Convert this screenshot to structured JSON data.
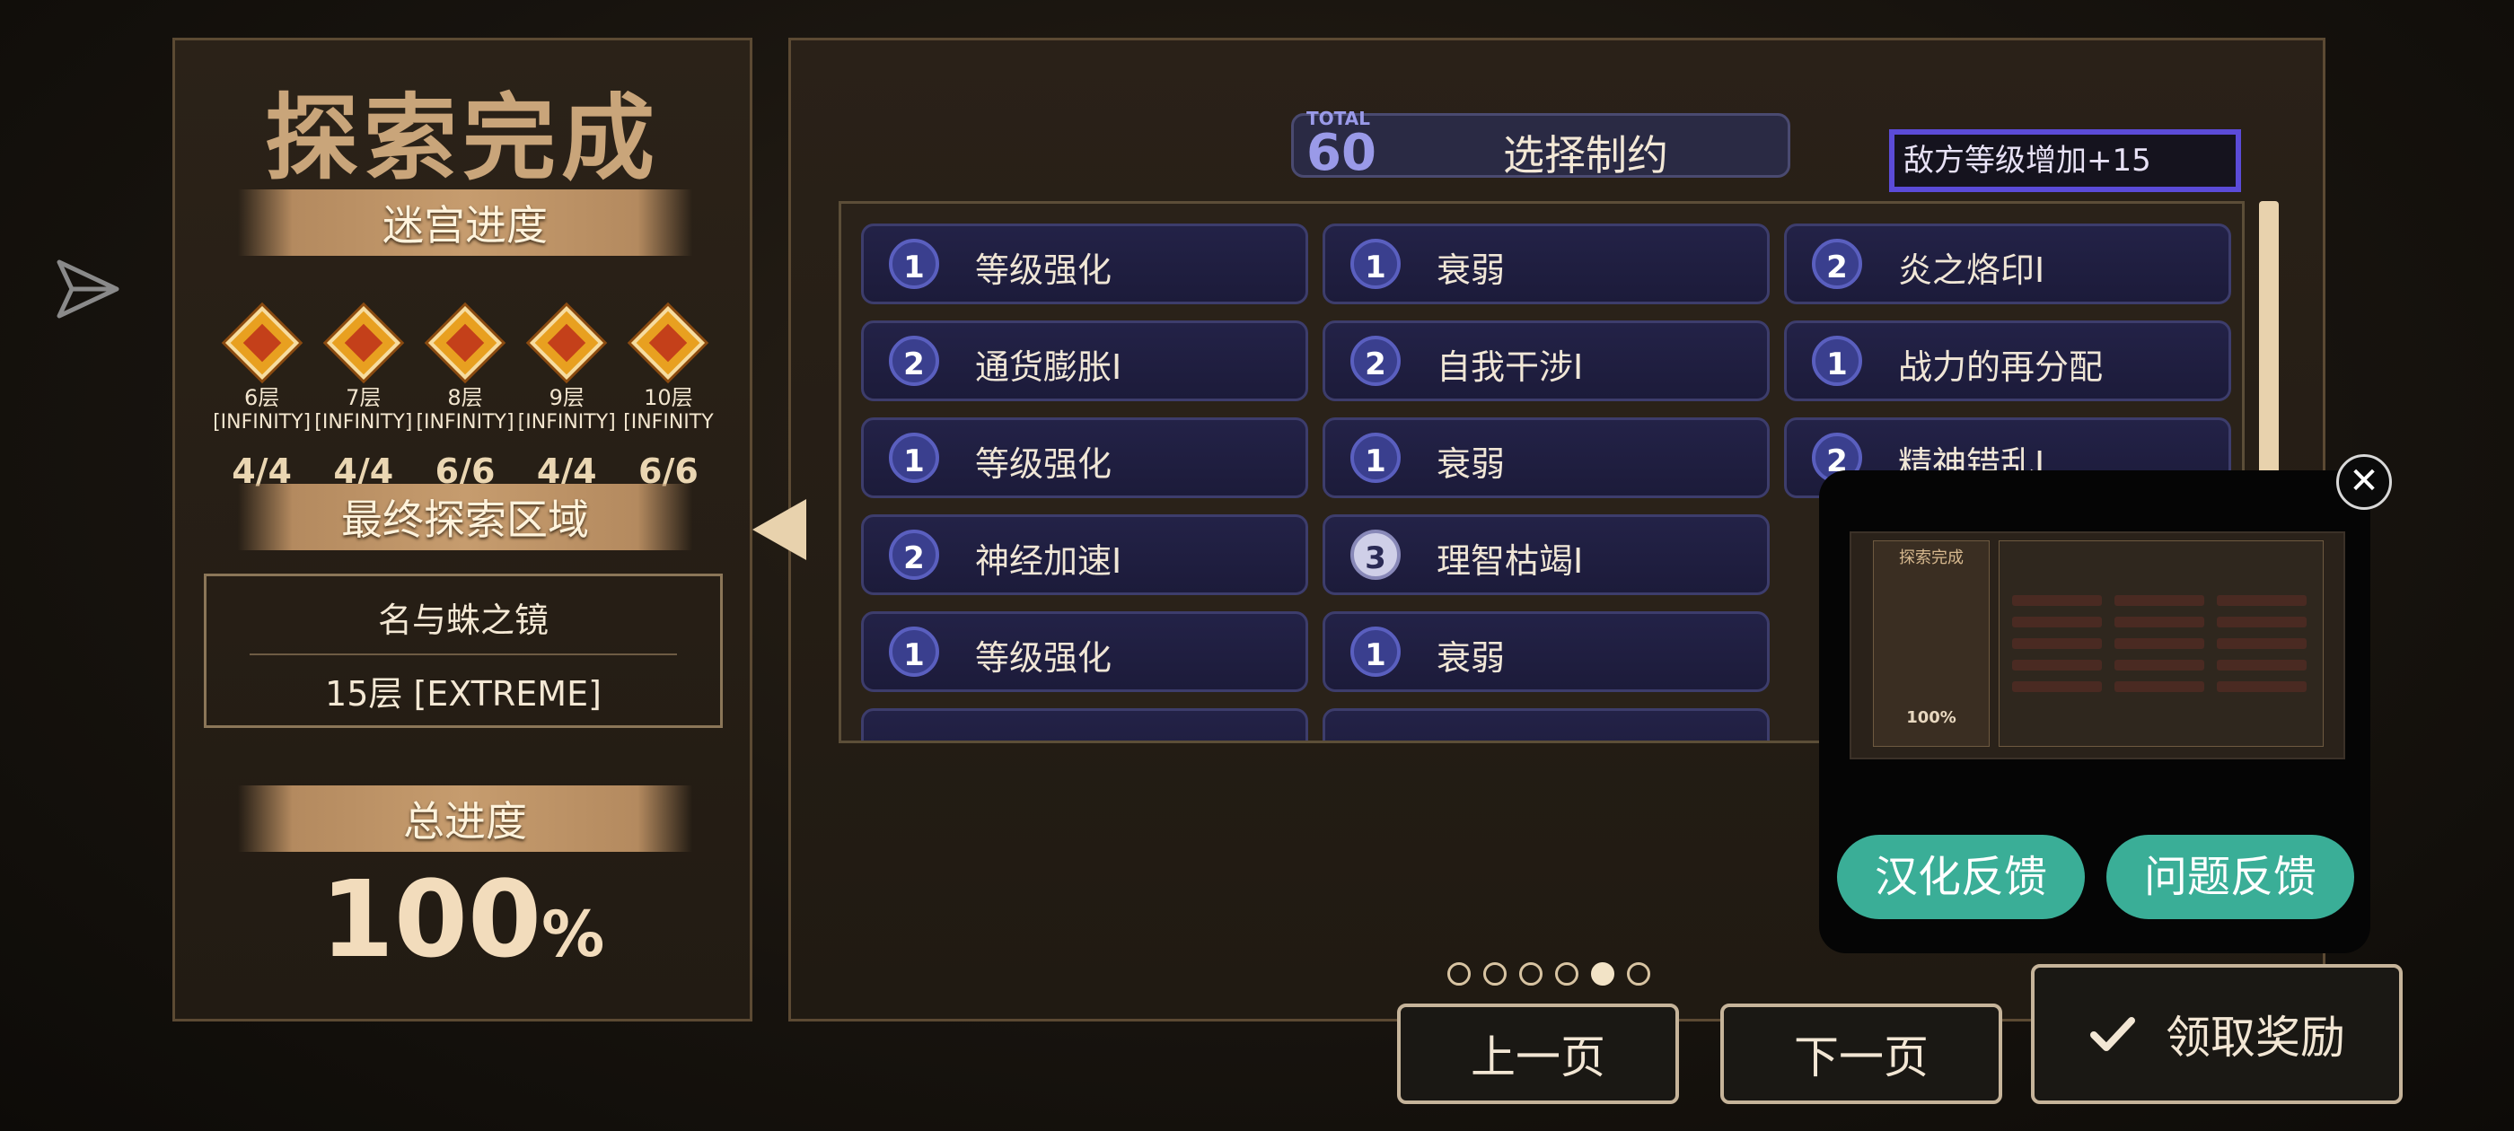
{
  "left": {
    "title": "探索完成",
    "maze_progress_label": "迷宫进度",
    "floors": [
      {
        "name": "6层",
        "difficulty": "[INFINITY]",
        "progress": "4/4"
      },
      {
        "name": "7层",
        "difficulty": "[INFINITY]",
        "progress": "4/4"
      },
      {
        "name": "8层",
        "difficulty": "[INFINITY]",
        "progress": "6/6"
      },
      {
        "name": "9层",
        "difficulty": "[INFINITY]",
        "progress": "4/4"
      },
      {
        "name": "10层",
        "difficulty": "[INFINITY",
        "progress": "6/6"
      }
    ],
    "final_area_label": "最终探索区域",
    "final_area_name": "名与蛛之镜",
    "final_area_level": "15层 [EXTREME]",
    "total_progress_label": "总进度",
    "total_progress_value": "100",
    "total_progress_unit": "%"
  },
  "main": {
    "total_label": "TOTAL",
    "total_value": "60",
    "select_title": "选择制约",
    "enemy_level_text": "敌方等级增加+15",
    "restrictions": [
      {
        "level": "1",
        "name": "等级强化"
      },
      {
        "level": "1",
        "name": "衰弱"
      },
      {
        "level": "2",
        "name": "炎之烙印I"
      },
      {
        "level": "2",
        "name": "通货膨胀I"
      },
      {
        "level": "2",
        "name": "自我干涉I"
      },
      {
        "level": "1",
        "name": "战力的再分配"
      },
      {
        "level": "1",
        "name": "等级强化"
      },
      {
        "level": "1",
        "name": "衰弱"
      },
      {
        "level": "2",
        "name": "精神错乱I"
      },
      {
        "level": "2",
        "name": "神经加速I"
      },
      {
        "level": "3",
        "name": "理智枯竭I"
      },
      {
        "level": "1",
        "name": "等级强化"
      },
      {
        "level": "1",
        "name": "衰弱"
      }
    ],
    "pages": 6,
    "active_page": 5
  },
  "buttons": {
    "prev_label": "上一页",
    "next_label": "下一页",
    "claim_label": "领取奖励"
  },
  "overlay": {
    "close_glyph": "✕",
    "thumb_title": "探索完成",
    "thumb_pct": "100%",
    "feedback_localization": "汉化反馈",
    "feedback_issue": "问题反馈"
  },
  "colors": {
    "accent_enemy_border": "#5b4bd8",
    "feedback_button": "#3aae97",
    "card_bg": "#232247"
  }
}
